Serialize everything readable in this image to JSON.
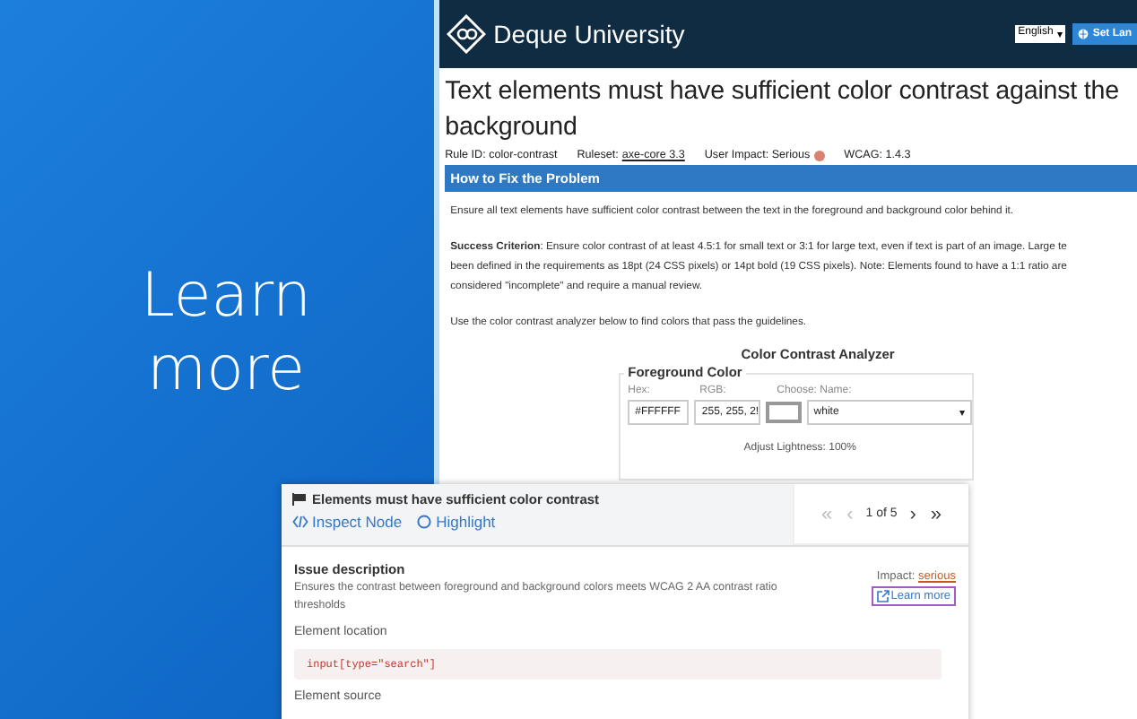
{
  "promo": {
    "heading": "Learn more"
  },
  "header": {
    "brand": "Deque University",
    "language": "English",
    "language_caret": "▾",
    "set_language": "Set Lan"
  },
  "article": {
    "title": "Text elements must have sufficient color contrast against the background",
    "meta": [
      {
        "label": "Rule ID:",
        "value": "color-contrast",
        "kind": "plain"
      },
      {
        "label": "Ruleset:",
        "value": "axe-core 3.3",
        "kind": "link"
      },
      {
        "label": "User Impact:",
        "value": "Serious",
        "kind": "impact",
        "color": "#d9826f"
      },
      {
        "label": "WCAG:",
        "value": "1.4.3",
        "kind": "plain"
      }
    ],
    "section_title": "How to Fix the Problem",
    "paragraphs": [
      "Ensure all text elements have sufficient color contrast between the text in the foreground and background color behind it.",
      "**Success Criterion**: Ensure color contrast of at least 4.5:1 for small text or 3:1 for large text, even if text is part of an image. Large te",
      "been defined in the requirements as 18pt (24 CSS pixels) or 14pt bold (19 CSS pixels). Note: Elements found to have a 1:1 ratio are",
      "considered \"incomplete\" and require a manual review.",
      "Use the color contrast analyzer below to find colors that pass the guidelines."
    ],
    "analyzer": {
      "title": "Color Contrast Analyzer",
      "section": "Foreground Color",
      "labels": [
        "Hex:",
        "RGB:",
        "Choose:",
        "Name:"
      ],
      "hex": "#FFFFFF",
      "rgb": "255, 255, 2!",
      "name": "white",
      "name_caret": "▾",
      "lightness": "Adjust Lightness: 100%"
    }
  },
  "issue_panel": {
    "title": "Elements must have sufficient color contrast",
    "actions": [
      "Inspect Node",
      "Highlight"
    ],
    "pager": {
      "first": {
        "label": "«",
        "disabled": true
      },
      "prev": {
        "label": "‹",
        "disabled": true
      },
      "position": "1 of 5",
      "next": {
        "label": "›",
        "disabled": false
      },
      "last": {
        "label": "»",
        "disabled": false
      }
    },
    "description_title": "Issue description",
    "description": "Ensures the contrast between foreground and background colors meets WCAG 2 AA contrast ratio thresholds",
    "impact_label": "Impact:",
    "impact_value": "serious",
    "learn_more": "Learn more",
    "location_title": "Element location",
    "location": "input[type=\"search\"]",
    "source_title": "Element source"
  }
}
